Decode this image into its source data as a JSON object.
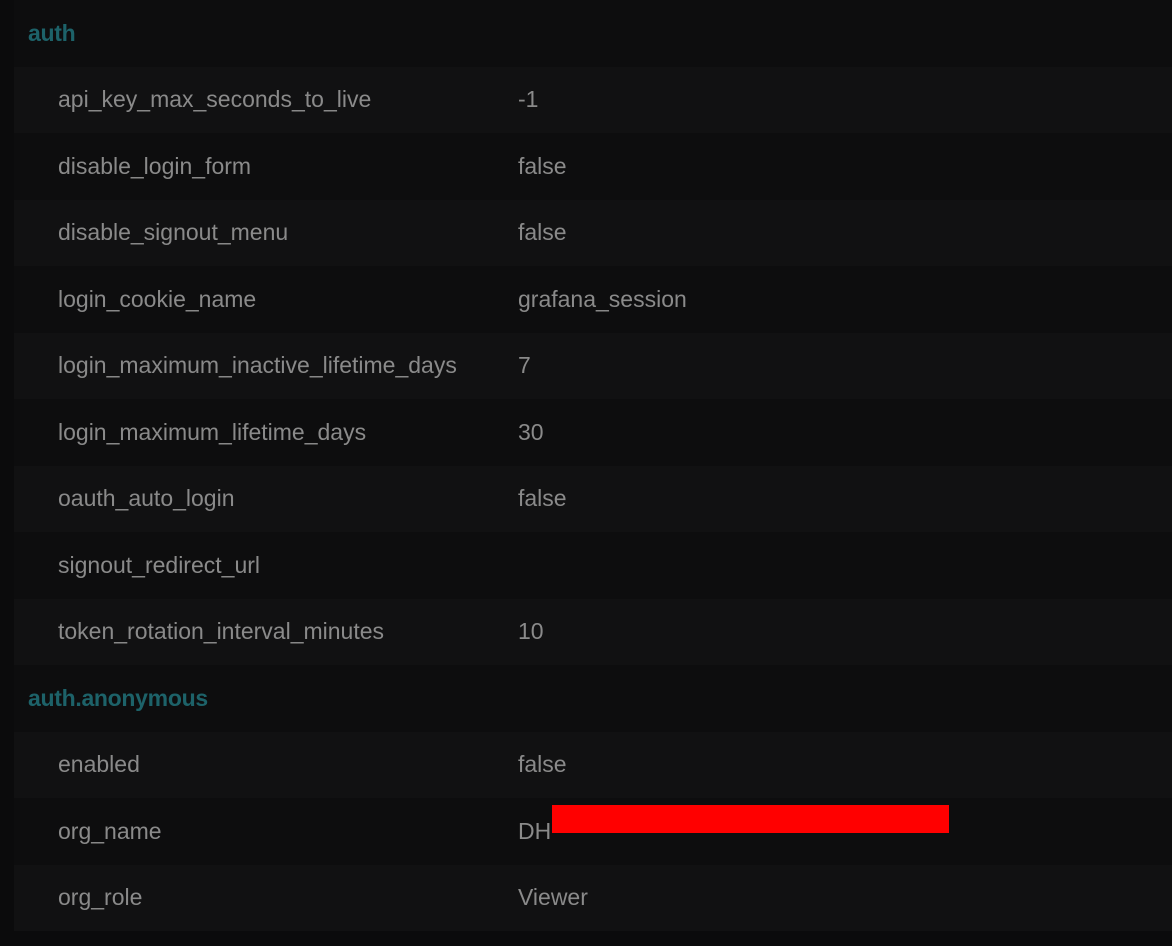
{
  "sections": [
    {
      "title": "auth",
      "rows": [
        {
          "key": "api_key_max_seconds_to_live",
          "value": "-1"
        },
        {
          "key": "disable_login_form",
          "value": "false"
        },
        {
          "key": "disable_signout_menu",
          "value": "false"
        },
        {
          "key": "login_cookie_name",
          "value": "grafana_session"
        },
        {
          "key": "login_maximum_inactive_lifetime_days",
          "value": "7"
        },
        {
          "key": "login_maximum_lifetime_days",
          "value": "30"
        },
        {
          "key": "oauth_auto_login",
          "value": "false"
        },
        {
          "key": "signout_redirect_url",
          "value": ""
        },
        {
          "key": "token_rotation_interval_minutes",
          "value": "10"
        }
      ]
    },
    {
      "title": "auth.anonymous",
      "rows": [
        {
          "key": "enabled",
          "value": "false"
        },
        {
          "key": "org_name",
          "value": "DH",
          "redacted": true
        },
        {
          "key": "org_role",
          "value": "Viewer"
        }
      ]
    }
  ],
  "colors": {
    "section_title": "#1d6269",
    "text": "#8a8a8a",
    "redaction": "#ff0000"
  }
}
